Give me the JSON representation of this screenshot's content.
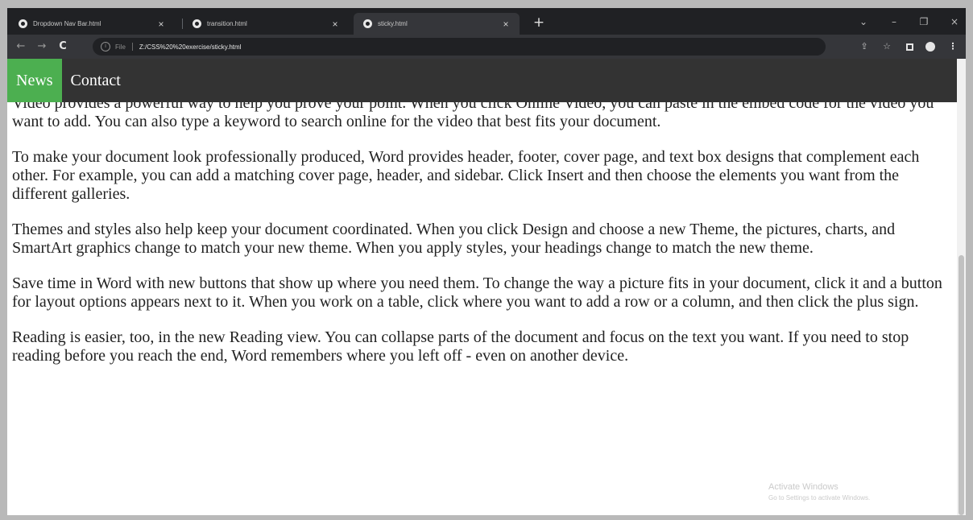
{
  "browser": {
    "tabs": [
      {
        "title": "Dropdown Nav Bar.html",
        "close": "×"
      },
      {
        "title": "transition.html",
        "close": "×"
      },
      {
        "title": "sticky.html",
        "close": "×",
        "active": true
      }
    ],
    "new_tab": "+",
    "window_controls": {
      "tab_search": "⌄",
      "minimize": "–",
      "maximize": "❐",
      "close": "×"
    },
    "nav": {
      "back": "←",
      "forward": "→",
      "reload": "C"
    },
    "address": {
      "info": "i",
      "scheme": "File",
      "url": "Z:/CSS%20%20exercise/sticky.html"
    },
    "toolbar_icons": {
      "share": "⇪",
      "bookmark": "☆"
    }
  },
  "page": {
    "navbar": [
      {
        "label": "News",
        "active": true
      },
      {
        "label": "Contact",
        "active": false
      }
    ],
    "paragraphs": [
      "Video provides a powerful way to help you prove your point. When you click Online Video, you can paste in the embed code for the video you want to add. You can also type a keyword to search online for the video that best fits your document.",
      "To make your document look professionally produced, Word provides header, footer, cover page, and text box designs that complement each other. For example, you can add a matching cover page, header, and sidebar. Click Insert and then choose the elements you want from the different galleries.",
      "Themes and styles also help keep your document coordinated. When you click Design and choose a new Theme, the pictures, charts, and SmartArt graphics change to match your new theme. When you apply styles, your headings change to match the new theme.",
      "Save time in Word with new buttons that show up where you need them. To change the way a picture fits in your document, click it and a button for layout options appears next to it. When you work on a table, click where you want to add a row or a column, and then click the plus sign.",
      "Reading is easier, too, in the new Reading view. You can collapse parts of the document and focus on the text you want. If you need to stop reading before you reach the end, Word remembers where you left off - even on another device."
    ]
  },
  "watermark": {
    "line1": "Activate Windows",
    "line2": "Go to Settings to activate Windows."
  },
  "colors": {
    "navbar": "#333333",
    "active_link": "#4caf50",
    "browser_frame": "#202124",
    "toolbar": "#35363a"
  }
}
